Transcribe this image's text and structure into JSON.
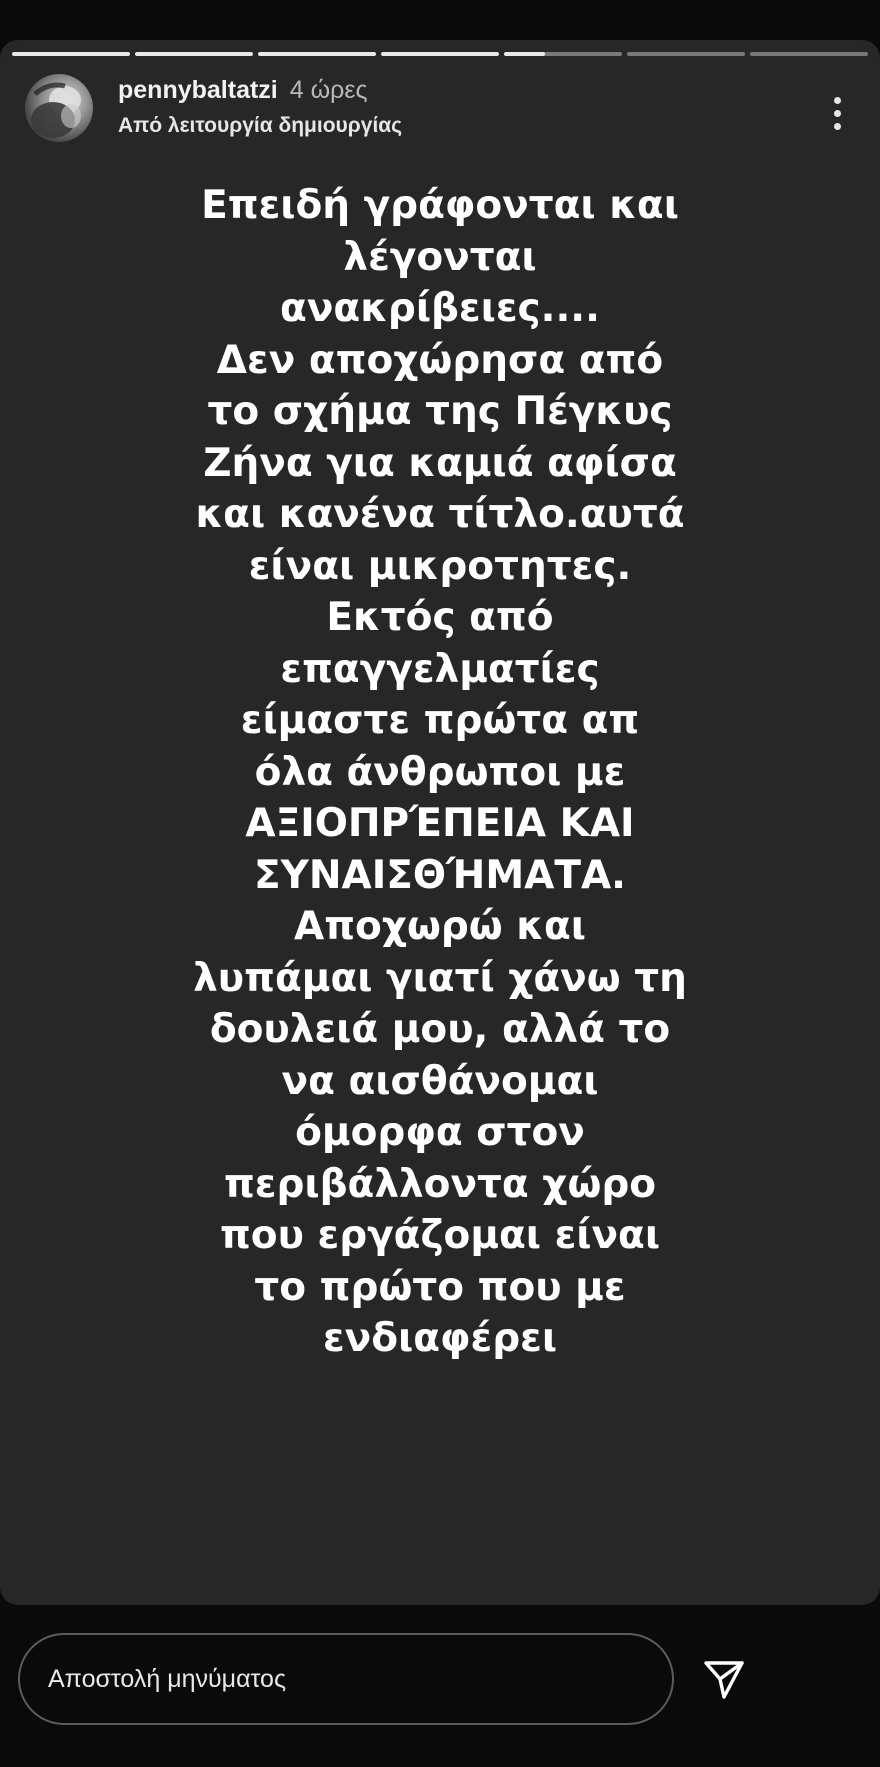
{
  "story": {
    "progress_segments": [
      1,
      1,
      1,
      1,
      0.35,
      0,
      0
    ],
    "username": "pennybaltatzi",
    "time_ago": "4 ώρες",
    "subtitle": "Από λειτουργία δημιουργίας",
    "text_lines": [
      "Επειδή γράφονται και",
      "λέγονται",
      "ανακρίβειες....",
      "Δεν αποχώρησα από",
      "το σχήμα της Πέγκυς",
      "Ζήνα για καμιά αφίσα",
      "και κανένα τίτλο.αυτά",
      "είναι μικροτητες.",
      "Εκτός από",
      "επαγγελματίες",
      "είμαστε πρώτα απ",
      "όλα άνθρωποι με",
      "ΑΞΙΟΠΡΈΠΕΙΑ ΚΑΙ",
      "ΣΥΝΑΙΣΘΉΜΑΤΑ.",
      "Αποχωρώ και",
      "λυπάμαι γιατί χάνω τη",
      "δουλειά μου, αλλά το",
      "να αισθάνομαι",
      "όμορφα στον",
      "περιβάλλοντα χώρο",
      "που εργάζομαι είναι",
      "το πρώτο που με",
      "ενδιαφέρει"
    ]
  },
  "reply": {
    "placeholder": "Αποστολή μηνύματος"
  },
  "icons": {
    "more": "more-vertical-icon",
    "send": "send-icon"
  }
}
